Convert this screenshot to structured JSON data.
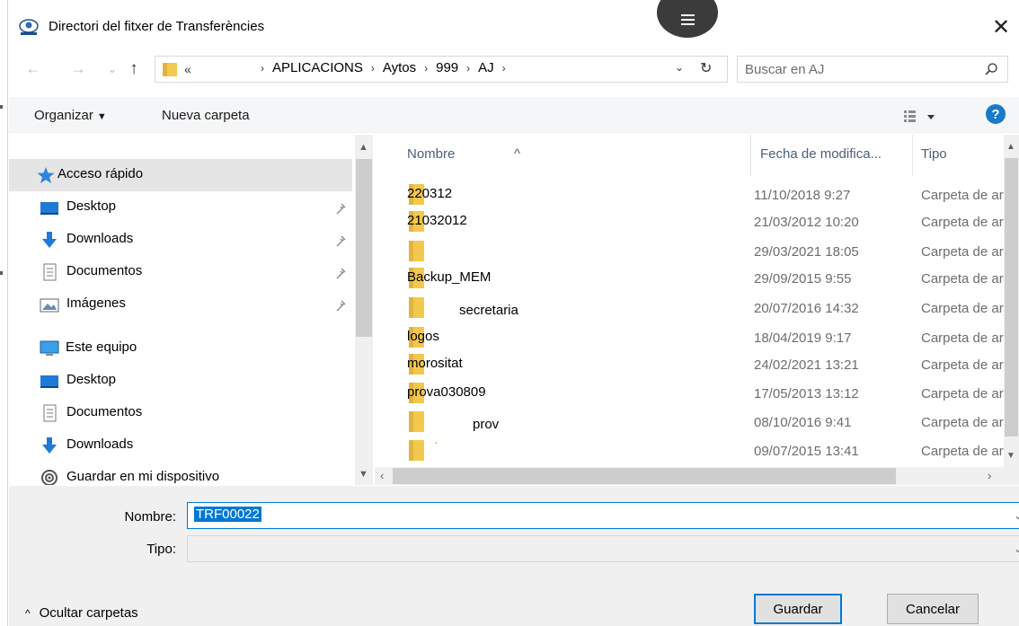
{
  "window": {
    "title": "Directori del fitxer de Transferències",
    "close_glyph": "✕"
  },
  "nav": {
    "back": "←",
    "forward": "→",
    "recent": "⌄",
    "up": "↑"
  },
  "address": {
    "overflow": "«",
    "crumbs": [
      "APLICACIONS",
      "Aytos",
      "999",
      "AJ"
    ],
    "separator": "›",
    "dropdown": "⌄",
    "refresh": "↻"
  },
  "search": {
    "placeholder": "Buscar en AJ"
  },
  "toolbar": {
    "organize_label": "Organizar",
    "organize_caret": "▼",
    "new_folder_label": "Nueva carpeta",
    "help": "?"
  },
  "sidebar": {
    "items": [
      {
        "label": "Acceso rápido",
        "icon": "star-icon"
      },
      {
        "label": "Desktop",
        "icon": "desktop-icon"
      },
      {
        "label": "Downloads",
        "icon": "download-icon"
      },
      {
        "label": "Documentos",
        "icon": "document-icon"
      },
      {
        "label": "Imágenes",
        "icon": "pictures-icon"
      },
      {
        "label": "Este equipo",
        "icon": "computer-icon"
      },
      {
        "label": "Desktop",
        "icon": "desktop-icon"
      },
      {
        "label": "Documentos",
        "icon": "document-icon"
      },
      {
        "label": "Downloads",
        "icon": "download-icon"
      },
      {
        "label": "Guardar en mi dispositivo",
        "icon": "device-icon"
      }
    ]
  },
  "files": {
    "columns": [
      "Nombre",
      "Fecha de modifica...",
      "Tipo"
    ],
    "rows": [
      {
        "name": "220312",
        "date": "11/10/2018 9:27",
        "type": "Carpeta de archivos"
      },
      {
        "name": "21032012",
        "date": "21/03/2012 10:20",
        "type": "Carpeta de archivos"
      },
      {
        "name": "",
        "date": "29/03/2021 18:05",
        "type": "Carpeta de archivos"
      },
      {
        "name": "Backup_MEM",
        "date": "29/09/2015 9:55",
        "type": "Carpeta de archivos"
      },
      {
        "name": "secretaria",
        "date": "20/07/2016 14:32",
        "type": "Carpeta de archivos"
      },
      {
        "name": "logos",
        "date": "18/04/2019 9:17",
        "type": "Carpeta de archivos"
      },
      {
        "name": "morositat",
        "date": "24/02/2021 13:21",
        "type": "Carpeta de archivos"
      },
      {
        "name": "prova030809",
        "date": "17/05/2013 13:12",
        "type": "Carpeta de archivos"
      },
      {
        "name": "prov",
        "date": "08/10/2016 9:41",
        "type": "Carpeta de archivos"
      },
      {
        "name": "·",
        "date": "09/07/2015 13:41",
        "type": "Carpeta de archivos"
      }
    ]
  },
  "form": {
    "name_label": "Nombre:",
    "name_value": "TRF00022",
    "type_label": "Tipo:",
    "type_value": ""
  },
  "footer": {
    "hide_folders": "Ocultar carpetas",
    "save": "Guardar",
    "cancel": "Cancelar"
  },
  "colors": {
    "accent": "#0078d7",
    "folder": "#f2c94c",
    "help": "#1979ca"
  }
}
